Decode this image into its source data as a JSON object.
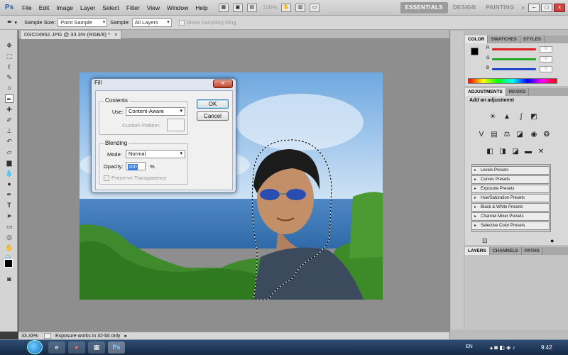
{
  "menubar": {
    "logo": "Ps",
    "items": [
      "File",
      "Edit",
      "Image",
      "Layer",
      "Select",
      "Filter",
      "View",
      "Window",
      "Help"
    ],
    "zoom": "100%",
    "workspaces": [
      "ESSENTIALS",
      "DESIGN",
      "PAINTING"
    ],
    "more": "»"
  },
  "options": {
    "sample_size_label": "Sample Size:",
    "sample_size_value": "Point Sample",
    "sample_label": "Sample:",
    "sample_value": "All Layers",
    "show_ring_label": "Show Sampling Ring"
  },
  "document": {
    "tab_label": "DSC04952.JPG @ 33.3% (RGB/8) *",
    "close": "×"
  },
  "status": {
    "zoom": "33.33%",
    "message": "Exposure works in 32-bit only"
  },
  "color_panel": {
    "tabs": [
      "COLOR",
      "SWATCHES",
      "STYLES"
    ],
    "channels": [
      {
        "label": "R",
        "value": "0"
      },
      {
        "label": "G",
        "value": "0"
      },
      {
        "label": "B",
        "value": "0"
      }
    ],
    "colors": {
      "r": "#d22",
      "g": "#2a2",
      "b": "#24c"
    }
  },
  "adjustments_panel": {
    "tabs": [
      "ADJUSTMENTS",
      "MASKS"
    ],
    "heading": "Add an adjustment",
    "presets": [
      "Levels Presets",
      "Curves Presets",
      "Exposure Presets",
      "Hue/Saturation Presets",
      "Black & White Presets",
      "Channel Mixer Presets",
      "Selective Color Presets"
    ]
  },
  "layers_panel": {
    "tabs": [
      "LAYERS",
      "CHANNELS",
      "PATHS"
    ]
  },
  "dialog": {
    "title": "Fill",
    "contents_label": "Contents",
    "use_label": "Use:",
    "use_value": "Content-Aware",
    "custom_pattern_label": "Custom Pattern:",
    "blending_label": "Blending",
    "mode_label": "Mode:",
    "mode_value": "Normal",
    "opacity_label": "Opacity:",
    "opacity_value": "100",
    "opacity_unit": "%",
    "preserve_label": "Preserve Transparency",
    "ok_label": "OK",
    "cancel_label": "Cancel"
  },
  "taskbar": {
    "lang": "EN",
    "time": "9:42"
  }
}
